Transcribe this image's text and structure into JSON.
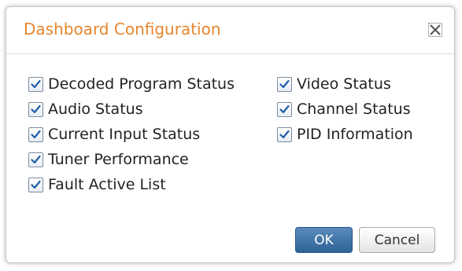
{
  "dialog": {
    "title": "Dashboard Configuration",
    "close_icon": "close-icon",
    "options_left": [
      {
        "label": "Decoded Program Status",
        "checked": true
      },
      {
        "label": "Audio Status",
        "checked": true
      },
      {
        "label": "Current Input Status",
        "checked": true
      },
      {
        "label": "Tuner Performance",
        "checked": true
      },
      {
        "label": "Fault Active List",
        "checked": true
      }
    ],
    "options_right": [
      {
        "label": "Video Status",
        "checked": true
      },
      {
        "label": "Channel Status",
        "checked": true
      },
      {
        "label": "PID Information",
        "checked": true
      }
    ],
    "ok_label": "OK",
    "cancel_label": "Cancel"
  },
  "colors": {
    "title": "#e6862e",
    "checkmark": "#1f5fa8",
    "ok_button": "#3a6fa3"
  }
}
